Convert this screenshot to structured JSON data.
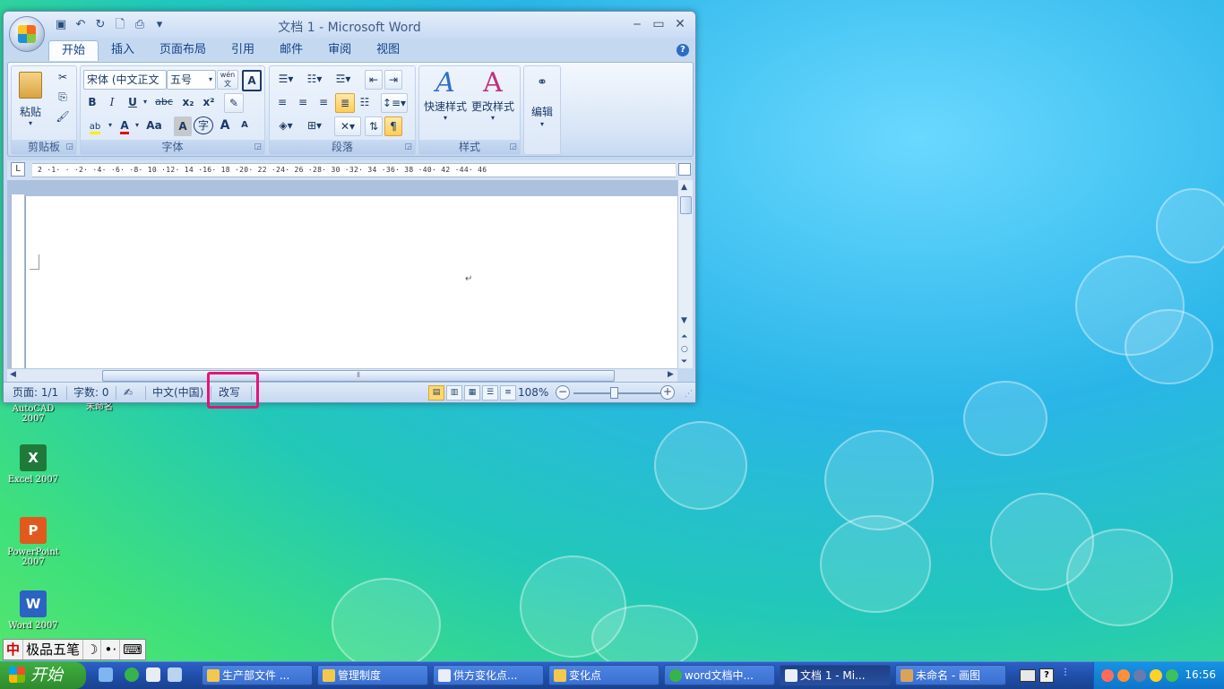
{
  "desktop": {
    "icons": [
      {
        "label_lines": [
          "AutoCAD",
          "2007"
        ]
      },
      {
        "label_lines": [
          "未命名"
        ]
      },
      {
        "label_lines": [
          "Excel 2007"
        ]
      },
      {
        "label_lines": [
          "PowerPoint",
          "2007"
        ]
      },
      {
        "label_lines": [
          "Word 2007"
        ]
      }
    ]
  },
  "window": {
    "title": "文档 1 - Microsoft Word",
    "tabs": [
      "开始",
      "插入",
      "页面布局",
      "引用",
      "邮件",
      "审阅",
      "视图"
    ],
    "active_tab": "开始"
  },
  "ribbon": {
    "clipboard": {
      "label": "剪贴板",
      "paste": "粘贴"
    },
    "font": {
      "label": "字体",
      "font_name": "宋体 (中文正文",
      "font_size": "五号",
      "bold": "B",
      "italic": "I",
      "underline": "U",
      "strike": "abc",
      "subscript": "x₂",
      "superscript": "x²",
      "highlight": "ab",
      "color": "A",
      "case": "Aa",
      "grow": "A",
      "shrink": "A",
      "phonetic": "wén 文",
      "char_border": "A",
      "char_shade": "A",
      "enclose": "字"
    },
    "paragraph": {
      "label": "段落"
    },
    "styles": {
      "label": "样式",
      "quick": "快速样式",
      "change": "更改样式"
    },
    "editing": {
      "label": "编辑"
    }
  },
  "ruler": {
    "corner": "L",
    "numbers": "2 ·1· · ·2· ·4· ·6· ·8· 10 ·12· 14 ·16· 18 ·20· 22 ·24· 26 ·28· 30 ·32· 34 ·36· 38 ·40· 42 ·44· 46"
  },
  "document": {
    "paragraph_mark": "↵"
  },
  "status": {
    "page": "页面: 1/1",
    "words": "字数: 0",
    "language": "中文(中国)",
    "mode": "改写",
    "zoom": "108%"
  },
  "ime": {
    "name": "极品五笔"
  },
  "taskbar": {
    "start": "开始",
    "tasks": [
      "生产部文件 ...",
      "管理制度",
      "供方变化点...",
      "变化点",
      "word文档中...",
      "文档 1 - Mi...",
      "未命名 - 画图"
    ],
    "clock": "16:56"
  },
  "colors": {
    "highlight_box": "#e8127a",
    "ribbon_text": "#15428b"
  }
}
